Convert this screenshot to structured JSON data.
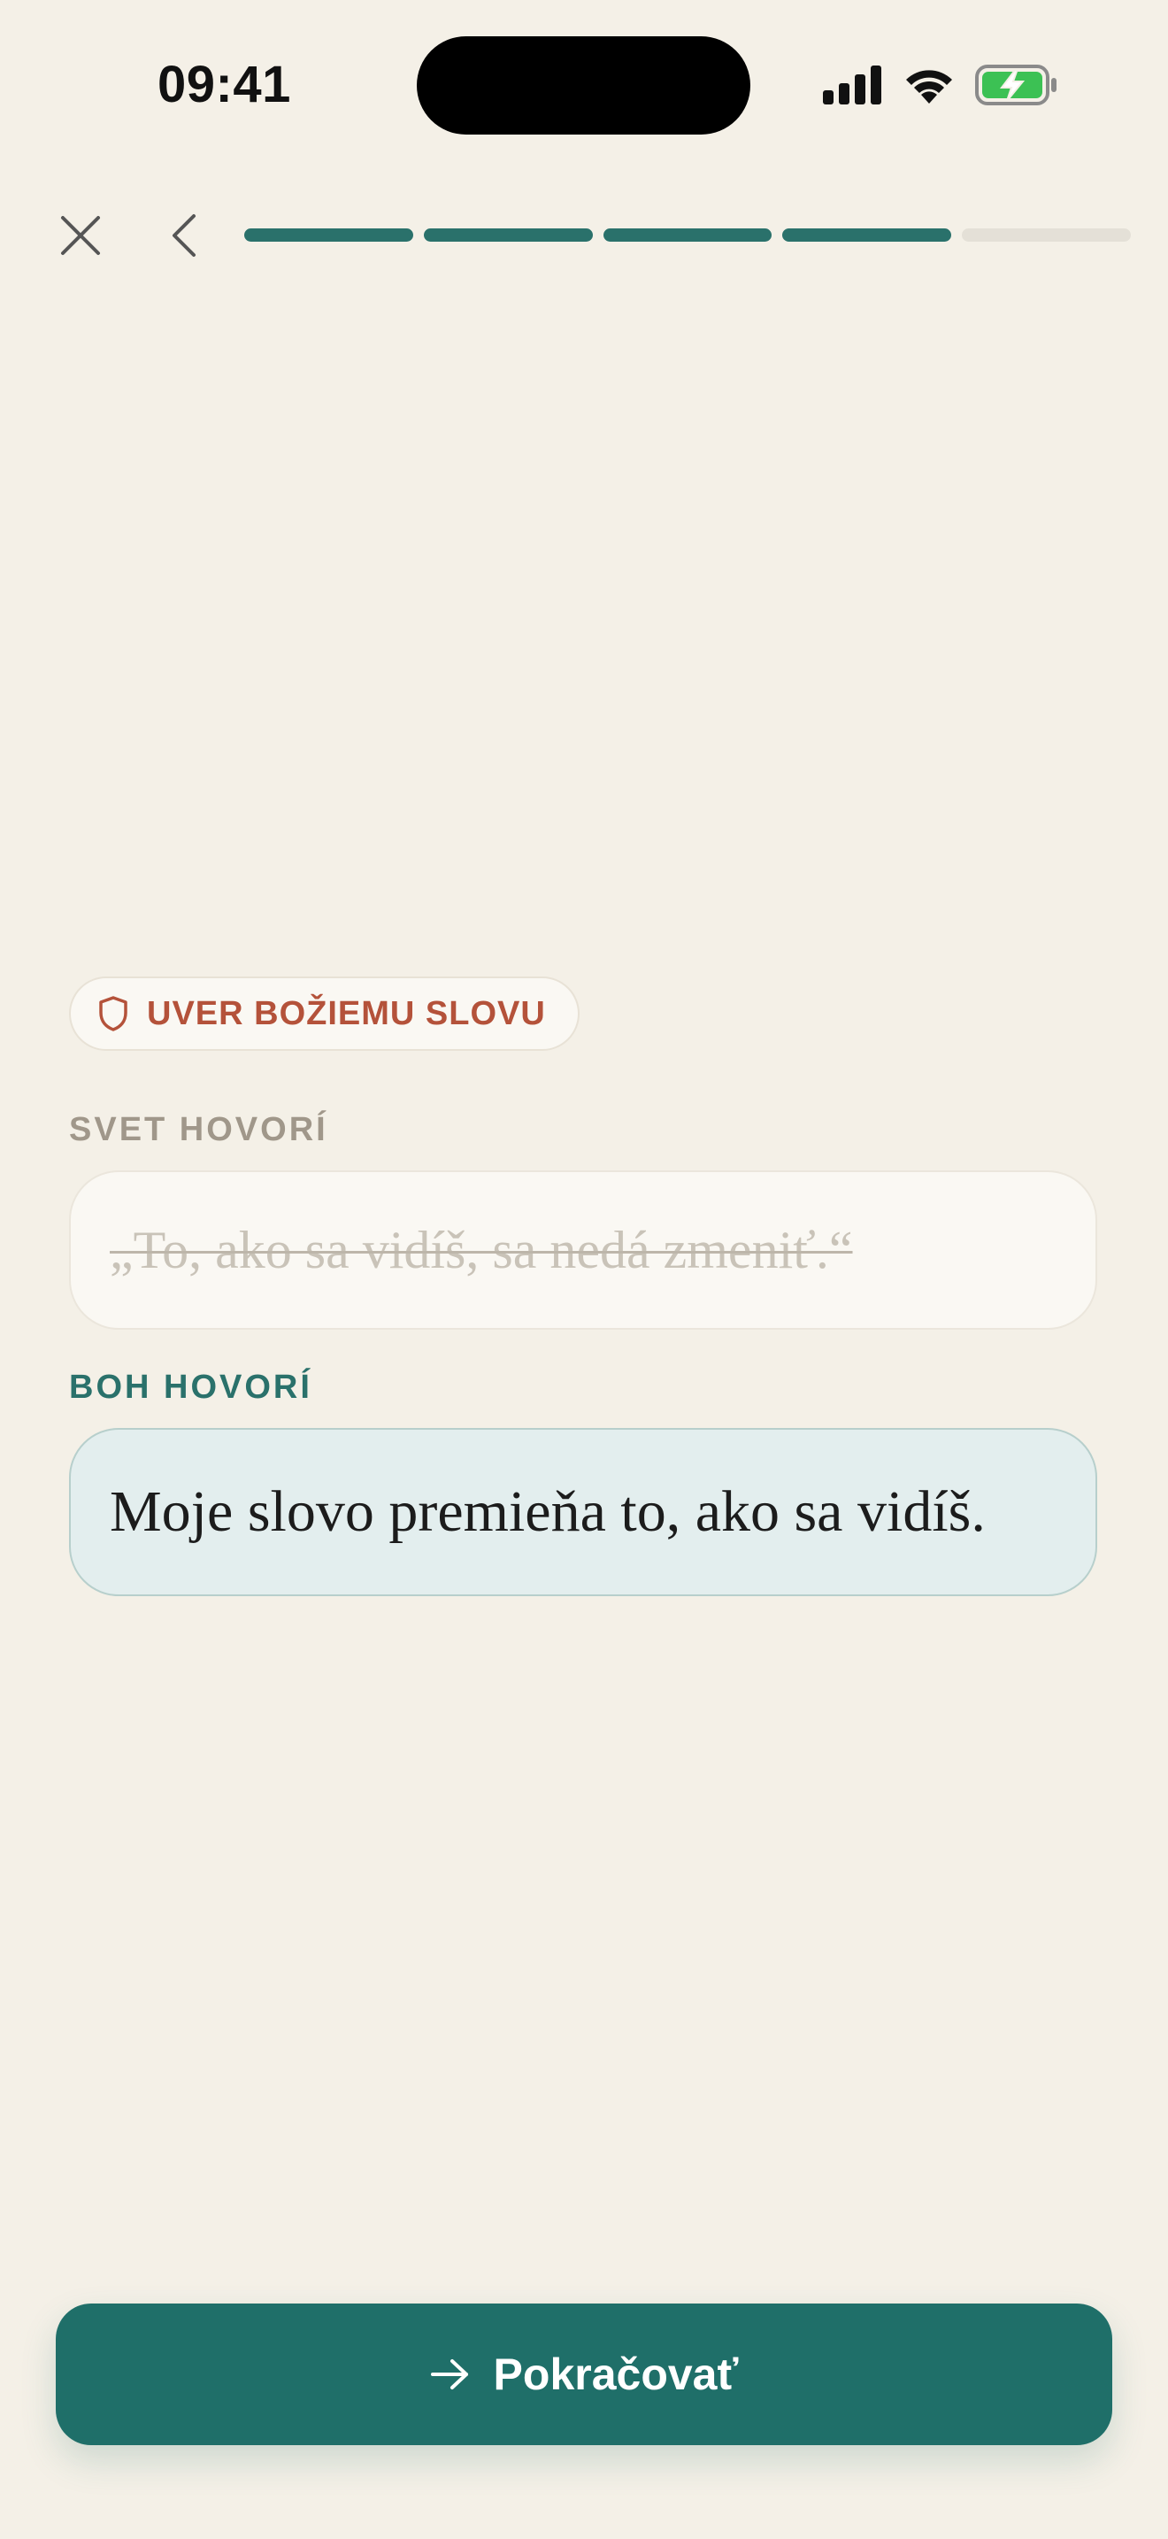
{
  "status_bar": {
    "time": "09:41"
  },
  "nav": {
    "progress": {
      "total_steps": 5,
      "completed_steps": 4
    }
  },
  "colors": {
    "accent": "#2a716b",
    "badge_text": "#b4523a",
    "background": "#f4f0e7"
  },
  "icons": {
    "close": "close-icon",
    "back": "chevron-left-icon",
    "badge": "shield-icon",
    "cta": "arrow-right-icon"
  },
  "badge": {
    "label": "UVER BOŽIEMU SLOVU"
  },
  "world": {
    "label": "SVET HOVORÍ",
    "quote": "„To, ako sa vidíš, sa nedá zmeniť.“"
  },
  "god": {
    "label": "BOH HOVORÍ",
    "quote": "Moje slovo premieňa to, ako sa vidíš."
  },
  "cta": {
    "label": "Pokračovať"
  }
}
